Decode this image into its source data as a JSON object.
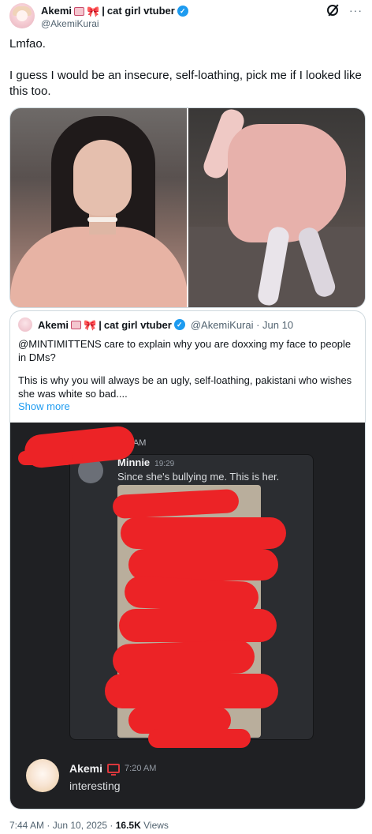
{
  "author": {
    "display_name_prefix": "Akemi",
    "display_name_suffix": "cat girl vtuber",
    "handle": "@AkemiKurai"
  },
  "tweet": {
    "line1": "Lmfao.",
    "line2": "I guess I would be an insecure, self-loathing, pick me if I looked like this too."
  },
  "quote": {
    "display_name_prefix": "Akemi",
    "display_name_suffix": "cat girl vtuber",
    "handle_date": "@AkemiKurai · Jun 10",
    "para1": "@MINTIMITTENS care to explain why you are doxxing my face to people in DMs?",
    "para2": "This is why you will always be an ugly, self-loathing, pakistani who wishes she was white so bad....",
    "show_more": "Show more",
    "screenshot": {
      "top_time": "7:20 AM",
      "user": "Minnie",
      "user_time": "19:29",
      "message": "Since she's bullying me. This is her.",
      "reply_user": "Akemi",
      "reply_time": "7:20 AM",
      "reply_message": "interesting"
    }
  },
  "footer": {
    "time_date": "7:44 AM · Jun 10, 2025 · ",
    "views_count": "16.5K",
    "views_label": " Views"
  },
  "icons": {
    "verified": "verified-check-icon",
    "grok": "grok-icon",
    "more": "more-icon",
    "monitor": "monitor-icon"
  },
  "colors": {
    "accent": "#1d9bf0",
    "redaction": "#ec2326",
    "discord_bg": "#1f2023"
  }
}
